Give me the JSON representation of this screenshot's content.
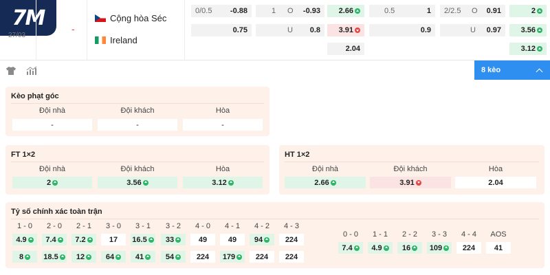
{
  "brand": {
    "logo_text": "7M"
  },
  "match": {
    "date": "27/03",
    "score": "-",
    "home_team": "Cộng hòa Séc",
    "away_team": "Ireland"
  },
  "odds_row": {
    "row1": [
      {
        "label": "0/0.5",
        "value": "-0.88"
      },
      {
        "label": "1",
        "value": ""
      },
      {
        "label": "O",
        "value": "-0.93"
      },
      {
        "label": "",
        "value": "2.66",
        "trend": "up"
      },
      {
        "label": "0.5",
        "value": "1"
      },
      {
        "label": "2/2.5",
        "value": ""
      },
      {
        "label": "O",
        "value": "0.91"
      },
      {
        "label": "",
        "value": "2",
        "trend": "up"
      }
    ],
    "row2": [
      {
        "label": "",
        "value": "0.75"
      },
      {
        "label": "U",
        "value": "0.8"
      },
      {
        "label": "",
        "value": "3.91",
        "trend": "down"
      },
      {
        "label": "",
        "value": "0.9"
      },
      {
        "label": "U",
        "value": "0.97"
      },
      {
        "label": "",
        "value": "3.56",
        "trend": "up"
      }
    ],
    "row3": [
      {
        "value": "2.04"
      },
      {
        "value": "3.12",
        "trend": "up"
      }
    ]
  },
  "toolbar": {
    "keo_label": "8 kèo"
  },
  "corner_card": {
    "title": "Kèo phạt góc",
    "columns": [
      "Đội nhà",
      "Đội khách",
      "Hòa"
    ],
    "values": [
      "-",
      "-",
      "-"
    ]
  },
  "ft_card": {
    "title": "FT 1×2",
    "columns": [
      "Đội nhà",
      "Đội khách",
      "Hòa"
    ],
    "values": [
      {
        "v": "2",
        "trend": "up"
      },
      {
        "v": "3.56",
        "trend": "up"
      },
      {
        "v": "3.12",
        "trend": "up"
      }
    ]
  },
  "ht_card": {
    "title": "HT 1×2",
    "columns": [
      "Đội nhà",
      "Đội khách",
      "Hòa"
    ],
    "values": [
      {
        "v": "2.66",
        "trend": "up"
      },
      {
        "v": "3.91",
        "trend": "down"
      },
      {
        "v": "2.04",
        "trend": ""
      }
    ]
  },
  "score_card": {
    "title": "Tỷ số chính xác toàn trận",
    "left_labels": [
      "1 - 0",
      "2 - 0",
      "2 - 1",
      "3 - 0",
      "3 - 1",
      "3 - 2",
      "4 - 0",
      "4 - 1",
      "4 - 2",
      "4 - 3"
    ],
    "left_row1": [
      {
        "v": "4.9",
        "trend": "up"
      },
      {
        "v": "7.4",
        "trend": "up"
      },
      {
        "v": "7.2",
        "trend": "up"
      },
      {
        "v": "17",
        "trend": ""
      },
      {
        "v": "16.5",
        "trend": "up"
      },
      {
        "v": "33",
        "trend": "up"
      },
      {
        "v": "49",
        "trend": ""
      },
      {
        "v": "49",
        "trend": ""
      },
      {
        "v": "94",
        "trend": "up"
      },
      {
        "v": "224",
        "trend": ""
      }
    ],
    "left_row2": [
      {
        "v": "8",
        "trend": "up"
      },
      {
        "v": "18.5",
        "trend": "up"
      },
      {
        "v": "12",
        "trend": "up"
      },
      {
        "v": "64",
        "trend": "up"
      },
      {
        "v": "41",
        "trend": "up"
      },
      {
        "v": "54",
        "trend": "up"
      },
      {
        "v": "224",
        "trend": ""
      },
      {
        "v": "179",
        "trend": "up"
      },
      {
        "v": "224",
        "trend": ""
      },
      {
        "v": "224",
        "trend": ""
      }
    ],
    "right_labels": [
      "0 - 0",
      "1 - 1",
      "2 - 2",
      "3 - 3",
      "4 - 4",
      "AOS"
    ],
    "right_row": [
      {
        "v": "7.4",
        "trend": "up"
      },
      {
        "v": "4.9",
        "trend": "up"
      },
      {
        "v": "16",
        "trend": "up"
      },
      {
        "v": "109",
        "trend": "up"
      },
      {
        "v": "224",
        "trend": ""
      },
      {
        "v": "41",
        "trend": ""
      }
    ]
  },
  "colors": {
    "brand_navy": "#152a55",
    "accent_blue": "#2f8ff0",
    "card_bg": "#fdf1e9",
    "up_bg": "#dff5e8",
    "down_bg": "#fbe3e3",
    "up_green": "#2fb468",
    "down_red": "#e14848"
  },
  "icons": [
    "shirt-icon",
    "stats-icon",
    "chevron-up-icon",
    "arrow-up-icon",
    "arrow-down-icon",
    "flag-czech-icon",
    "flag-ireland-icon"
  ]
}
